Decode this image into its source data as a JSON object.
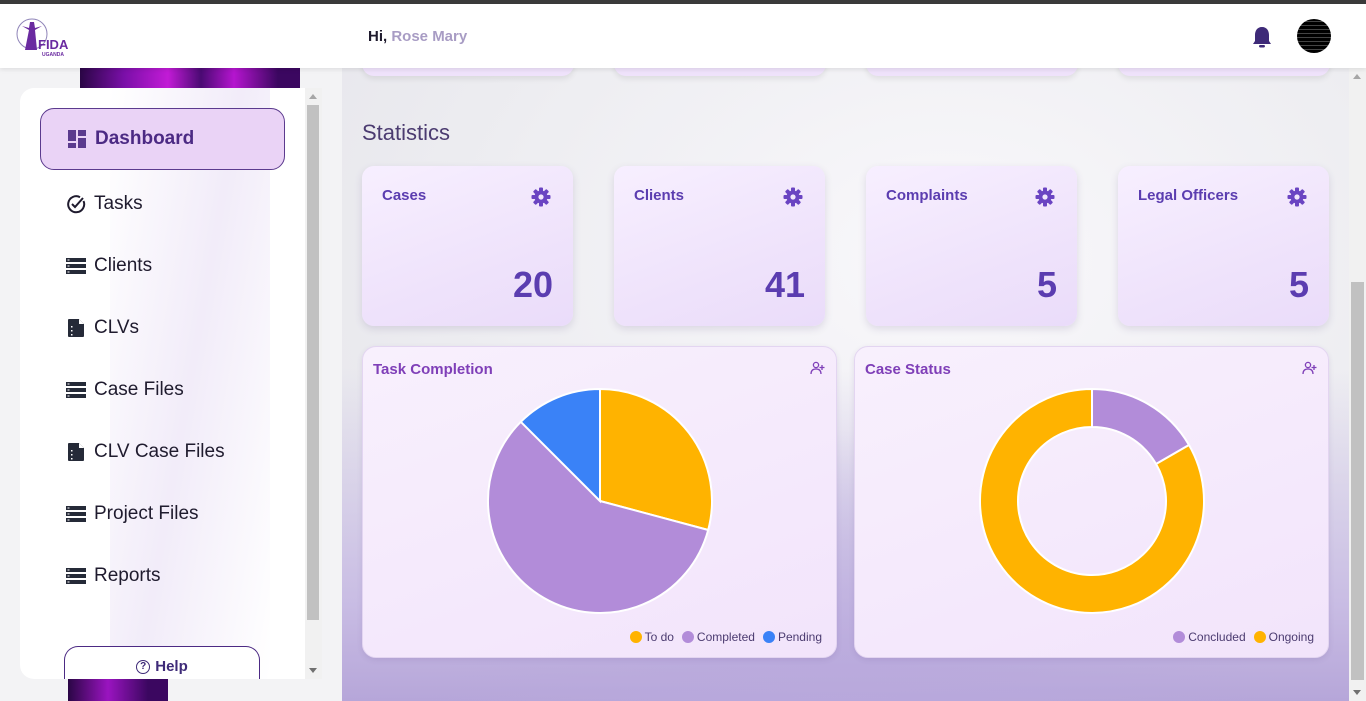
{
  "header": {
    "logo_text": "FIDA",
    "logo_subtext": "UGANDA",
    "greeting_prefix": "Hi,",
    "user_name": "Rose Mary",
    "notification_icon": "bell-icon",
    "avatar_icon": "user-avatar"
  },
  "sidebar": {
    "items": [
      {
        "label": "Dashboard",
        "icon": "dashboard-icon",
        "active": true
      },
      {
        "label": "Tasks",
        "icon": "check-circle-icon",
        "active": false
      },
      {
        "label": "Clients",
        "icon": "list-icon",
        "active": false
      },
      {
        "label": "CLVs",
        "icon": "file-icon",
        "active": false
      },
      {
        "label": "Case Files",
        "icon": "list-icon",
        "active": false
      },
      {
        "label": "CLV Case Files",
        "icon": "file-icon",
        "active": false
      },
      {
        "label": "Project Files",
        "icon": "list-icon",
        "active": false
      },
      {
        "label": "Reports",
        "icon": "list-icon",
        "active": false
      }
    ],
    "help_label": "Help"
  },
  "main": {
    "section_title": "Statistics",
    "stats": [
      {
        "label": "Cases",
        "value": "20",
        "icon": "gear-icon"
      },
      {
        "label": "Clients",
        "value": "41",
        "icon": "gear-icon"
      },
      {
        "label": "Complaints",
        "value": "5",
        "icon": "gear-icon"
      },
      {
        "label": "Legal Officers",
        "value": "5",
        "icon": "gear-icon"
      }
    ]
  },
  "colors": {
    "accent": "#5b3db0",
    "todo": "#ffb300",
    "completed": "#b28cd9",
    "pending": "#3a82f7",
    "concluded": "#b28cd9",
    "ongoing": "#ffb300"
  },
  "chart_data": [
    {
      "type": "pie",
      "title": "Task Completion",
      "categories": [
        "To do",
        "Completed",
        "Pending"
      ],
      "values": [
        7,
        14,
        3
      ],
      "colors": [
        "#ffb300",
        "#b28cd9",
        "#3a82f7"
      ],
      "legend": "bottom-right"
    },
    {
      "type": "pie",
      "subtype": "donut",
      "title": "Case Status",
      "categories": [
        "Concluded",
        "Ongoing"
      ],
      "values": [
        1,
        5
      ],
      "colors": [
        "#b28cd9",
        "#ffb300"
      ],
      "legend": "bottom-right"
    }
  ]
}
